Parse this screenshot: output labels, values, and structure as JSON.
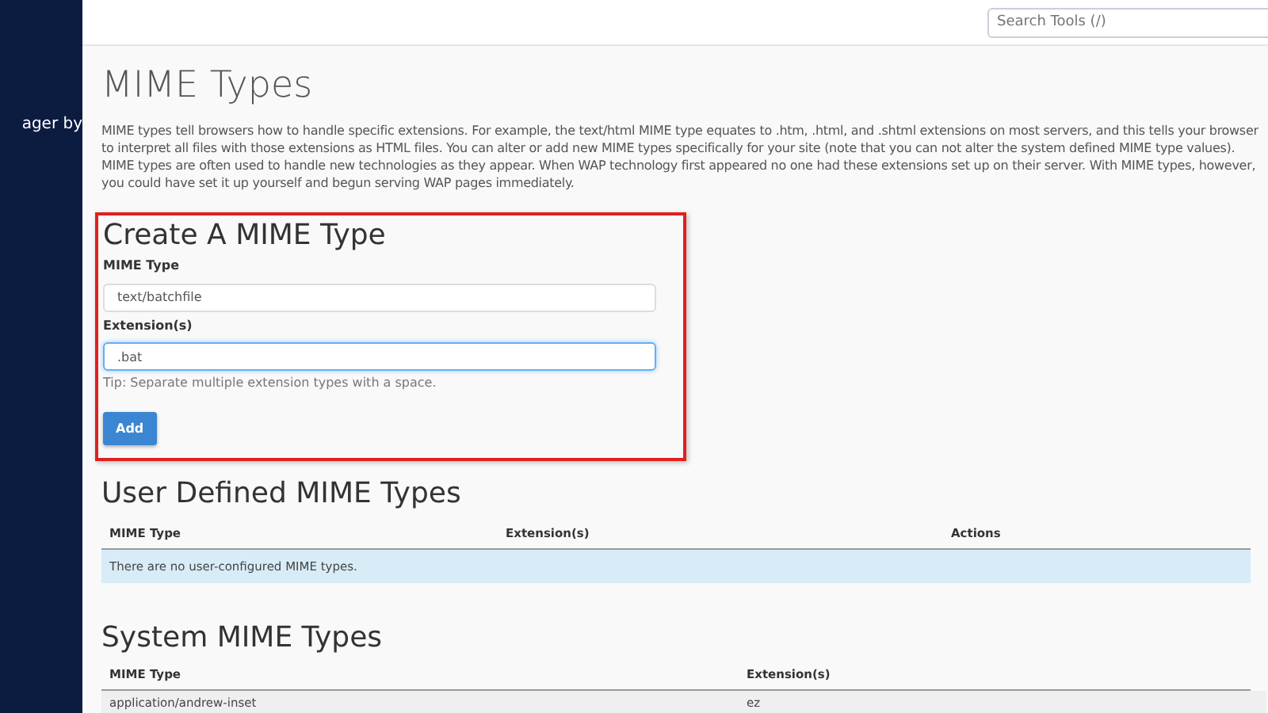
{
  "sidebar": {
    "text": "ager by"
  },
  "search": {
    "placeholder": "Search Tools (/)"
  },
  "page": {
    "title": "MIME Types",
    "description": "MIME types tell browsers how to handle specific extensions. For example, the text/html MIME type equates to .htm, .html, and .shtml extensions on most servers, and this tells your browser to interpret all files with those extensions as HTML files. You can alter or add new MIME types specifically for your site (note that you can not alter the system defined MIME type values). MIME types are often used to handle new technologies as they appear. When WAP technology first appeared no one had these extensions set up on their server. With MIME types, however, you could have set it up yourself and begun serving WAP pages immediately."
  },
  "create_form": {
    "title": "Create A MIME Type",
    "highlighted": true,
    "fields": [
      {
        "label": "MIME Type",
        "value": "text/batchfile",
        "focused": false
      },
      {
        "label": "Extension(s)",
        "value": ".bat",
        "focused": true
      }
    ],
    "tip": "Tip: Separate multiple extension types with a space.",
    "button": "Add"
  },
  "user_defined": {
    "title": "User Defined MIME Types",
    "columns": [
      "MIME Type",
      "Extension(s)",
      "Actions"
    ],
    "empty_message": "There are no user-configured MIME types."
  },
  "system": {
    "title": "System MIME Types",
    "columns": [
      "MIME Type",
      "Extension(s)"
    ],
    "rows": [
      [
        "application/andrew-inset",
        "ez"
      ]
    ]
  }
}
